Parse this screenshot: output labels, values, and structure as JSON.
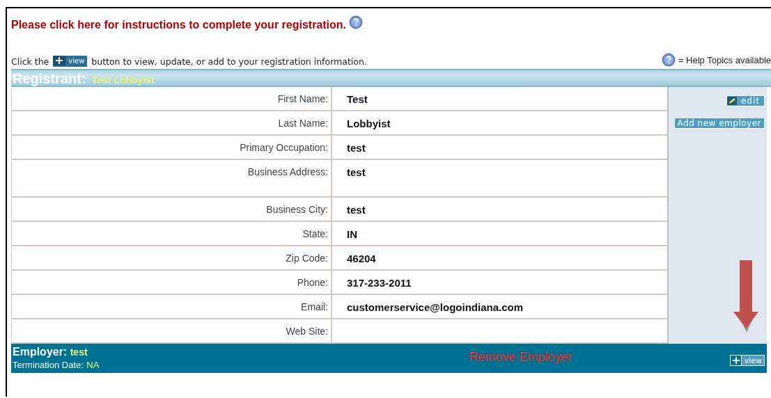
{
  "instructions_link": "Please click here for instructions to complete your registration.",
  "intro": {
    "before": "Click the",
    "button": "view",
    "after": "button to view, update, or add to your registration information."
  },
  "help_legend": "= Help Topics available",
  "registrant": {
    "heading": "Registrant:",
    "name": "Test Lobbyist"
  },
  "fields": [
    {
      "label": "First Name:",
      "value": "Test",
      "tall": false
    },
    {
      "label": "Last Name:",
      "value": "Lobbyist",
      "tall": false
    },
    {
      "label": "Primary Occupation:",
      "value": "test",
      "tall": false
    },
    {
      "label": "Business Address:",
      "value": "test",
      "tall": true
    },
    {
      "label": "Business City:",
      "value": "test",
      "tall": false
    },
    {
      "label": "State:",
      "value": "IN",
      "tall": false
    },
    {
      "label": "Zip Code:",
      "value": "46204",
      "tall": false
    },
    {
      "label": "Phone:",
      "value": "317-233-2011",
      "tall": false
    },
    {
      "label": "Email:",
      "value": "customerservice@logoindiana.com",
      "tall": false
    },
    {
      "label": "Web Site:",
      "tall": false
    }
  ],
  "actions": {
    "edit": "edit",
    "add": "Add new employer"
  },
  "employer": {
    "heading": "Employer:",
    "name": "test",
    "termination_label": "Termination Date:",
    "termination_value": "NA",
    "remove": "Remove Employer",
    "view": "view"
  }
}
